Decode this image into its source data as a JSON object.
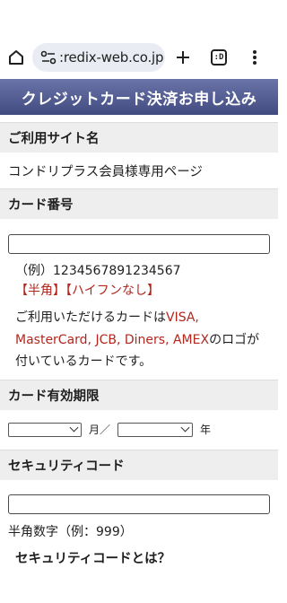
{
  "browser": {
    "url": ":redix-web.co.jp",
    "tab_count": ":D"
  },
  "page": {
    "header": "クレジットカード決済お申し込み",
    "site_section": {
      "heading": "ご利用サイト名",
      "value": "コンドリプラス会員様専用ページ"
    },
    "card_section": {
      "heading": "カード番号",
      "input_value": "",
      "example": "（例）1234567891234567",
      "note": "【半角】【ハイフンなし】",
      "brands_prefix": "ご利用いただけるカードは",
      "brands_list": "VISA, MasterCard, JCB, Diners, AMEX",
      "brands_suffix": "のロゴが付いているカードです。"
    },
    "expiry_section": {
      "heading": "カード有効期限",
      "month_value": "",
      "month_unit": "月／",
      "year_value": "",
      "year_unit": "年"
    },
    "security_section": {
      "heading": "セキュリティコード",
      "input_value": "",
      "note": "半角数字（例：999）",
      "link": "セキュリティコードとは？"
    }
  },
  "colors": {
    "header_bg": "#4e5890",
    "accent_red": "#b3261e",
    "section_bg": "#eeeeee"
  }
}
